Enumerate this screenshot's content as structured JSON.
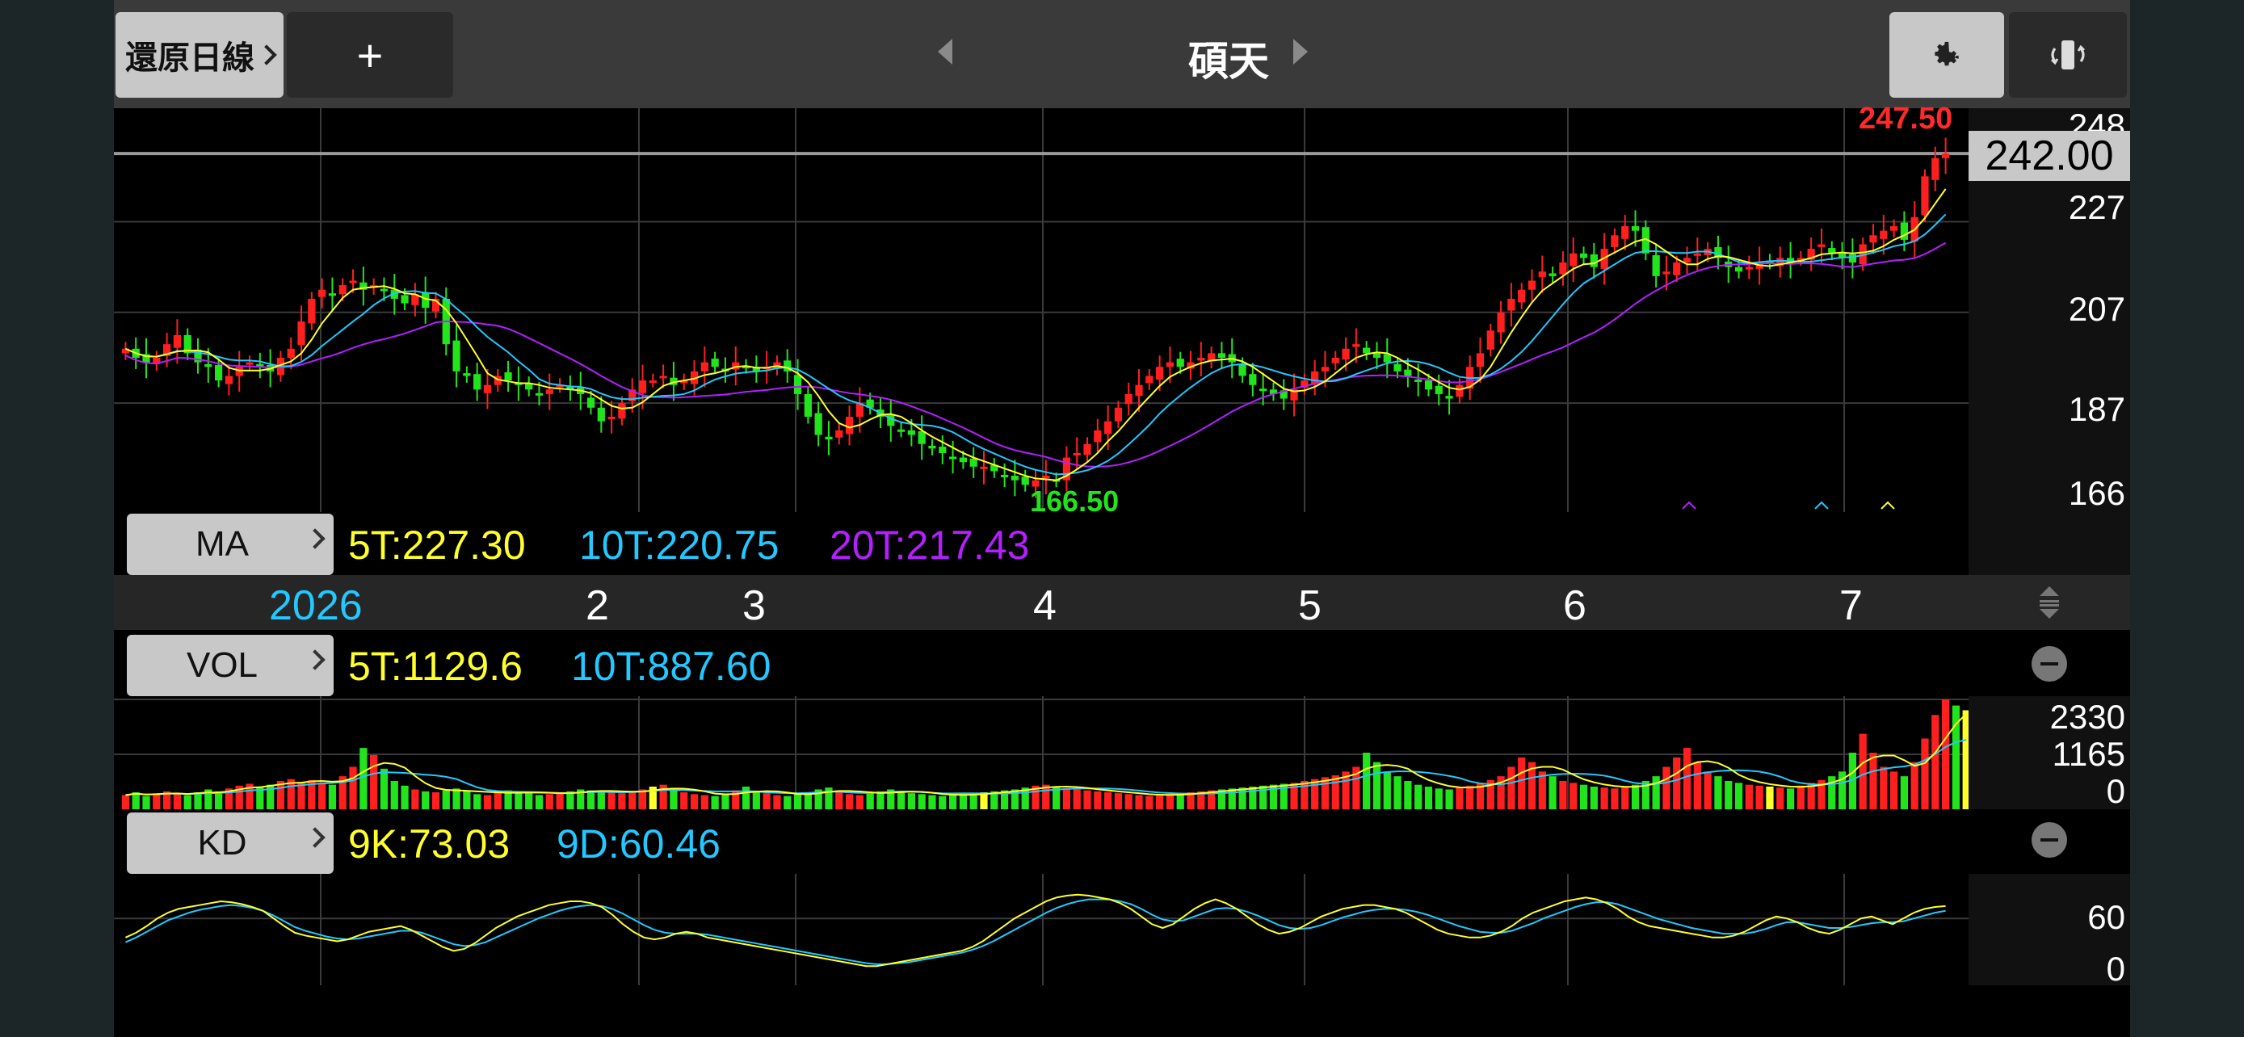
{
  "toolbar": {
    "restore_label": "還原日線",
    "add_label": "+",
    "stock_name": "碩天",
    "gear_icon": "gear-icon",
    "rotate_icon": "rotate-screen-icon"
  },
  "colors": {
    "up": "#ff1f1f",
    "down": "#22e41c",
    "ma5": "#ffff2a",
    "ma10": "#22c8ff",
    "ma20": "#b41fff",
    "grid": "#3a3a3a"
  },
  "ma_panel": {
    "button": "MA",
    "ma5": "5T:227.30",
    "ma10": "10T:220.75",
    "ma20": "20T:217.43"
  },
  "vol_panel": {
    "button": "VOL",
    "ma5": "5T:1129.6",
    "ma10": "10T:887.60"
  },
  "kd_panel": {
    "button": "KD",
    "k": "9K:73.03",
    "d": "9D:60.46"
  },
  "chart_data": {
    "type": "candlestick",
    "current_price": "242.00",
    "high_label": "247.50",
    "low_label": "166.50",
    "price_axis": [
      "248",
      "227",
      "207",
      "187",
      "166"
    ],
    "price_range": [
      163,
      252
    ],
    "months": [
      "2026",
      "2",
      "3",
      "4",
      "5",
      "6",
      "7"
    ],
    "closes": [
      199,
      197,
      196,
      197,
      200,
      202,
      198,
      196,
      195,
      192,
      193,
      195,
      196,
      195,
      194,
      197,
      199,
      205,
      210,
      212,
      211,
      213,
      214,
      212,
      213,
      212,
      210,
      209,
      211,
      208,
      210,
      200,
      194,
      193,
      190,
      191,
      193,
      192,
      191,
      190,
      189,
      190,
      191,
      190,
      189,
      186,
      183,
      184,
      187,
      190,
      192,
      192,
      193,
      191,
      192,
      194,
      196,
      195,
      194,
      196,
      195,
      194,
      195,
      196,
      194,
      189,
      184,
      180,
      179,
      181,
      184,
      187,
      186,
      184,
      182,
      181,
      180,
      178,
      177,
      176,
      175,
      174,
      173,
      173,
      172,
      171,
      170,
      169,
      170,
      171,
      170,
      175,
      176,
      178,
      181,
      183,
      186,
      189,
      191,
      193,
      195,
      196,
      195,
      196,
      197,
      198,
      197,
      196,
      193,
      191,
      190,
      189,
      188,
      190,
      192,
      194,
      195,
      197,
      199,
      200,
      198,
      197,
      196,
      194,
      193,
      192,
      190,
      189,
      188,
      191,
      195,
      198,
      203,
      207,
      210,
      212,
      214,
      216,
      215,
      218,
      220,
      219,
      217,
      221,
      224,
      226,
      225,
      220,
      215,
      216,
      218,
      219,
      220,
      221,
      219,
      217,
      216,
      217,
      218,
      218,
      219,
      218,
      219,
      221,
      222,
      220,
      219,
      218,
      222,
      224,
      225,
      226,
      223,
      228,
      237,
      241,
      242
    ],
    "volume_axis": [
      "2330",
      "1165",
      "0"
    ],
    "volume_max": 2330,
    "volume": [
      300,
      360,
      280,
      340,
      380,
      320,
      300,
      360,
      420,
      380,
      440,
      500,
      540,
      480,
      520,
      600,
      640,
      580,
      620,
      560,
      520,
      700,
      900,
      1300,
      1150,
      860,
      600,
      500,
      420,
      380,
      360,
      400,
      440,
      380,
      320,
      300,
      350,
      400,
      380,
      340,
      300,
      320,
      360,
      380,
      420,
      400,
      380,
      360,
      340,
      380,
      420,
      480,
      520,
      400,
      360,
      320,
      300,
      280,
      320,
      400,
      480,
      380,
      340,
      300,
      280,
      320,
      360,
      420,
      460,
      380,
      320,
      300,
      340,
      380,
      420,
      380,
      340,
      320,
      300,
      280,
      300,
      320,
      340,
      360,
      380,
      400,
      420,
      460,
      500,
      520,
      480,
      440,
      420,
      400,
      380,
      360,
      340,
      320,
      300,
      280,
      300,
      320,
      340,
      360,
      380,
      400,
      420,
      440,
      460,
      480,
      500,
      520,
      540,
      560,
      600,
      640,
      680,
      720,
      800,
      900,
      1200,
      1000,
      800,
      700,
      600,
      520,
      480,
      440,
      420,
      460,
      500,
      560,
      620,
      700,
      900,
      1100,
      1000,
      800,
      700,
      600,
      560,
      520,
      480,
      460,
      440,
      480,
      520,
      600,
      700,
      900,
      1100,
      1300,
      1000,
      800,
      700,
      600,
      560,
      520,
      500,
      480,
      460,
      440,
      500,
      560,
      620,
      700,
      800,
      1200,
      1600,
      1200,
      900,
      800,
      700,
      1000,
      1500,
      2000,
      2330,
      2200,
      2100
    ],
    "kd_axis": [
      "60",
      "0"
    ],
    "k": [
      40,
      45,
      52,
      60,
      66,
      70,
      72,
      74,
      76,
      78,
      77,
      75,
      72,
      68,
      60,
      52,
      45,
      42,
      40,
      38,
      36,
      38,
      42,
      46,
      48,
      50,
      52,
      48,
      42,
      36,
      30,
      26,
      28,
      34,
      42,
      50,
      56,
      62,
      66,
      70,
      74,
      76,
      78,
      78,
      76,
      72,
      64,
      54,
      46,
      40,
      38,
      40,
      44,
      46,
      44,
      40,
      38,
      36,
      34,
      32,
      30,
      28,
      26,
      24,
      22,
      20,
      18,
      16,
      14,
      12,
      10,
      10,
      12,
      14,
      16,
      18,
      20,
      22,
      24,
      26,
      30,
      36,
      44,
      52,
      60,
      66,
      72,
      78,
      82,
      84,
      85,
      84,
      82,
      80,
      76,
      70,
      62,
      54,
      50,
      54,
      62,
      70,
      76,
      80,
      76,
      70,
      62,
      54,
      48,
      44,
      46,
      50,
      56,
      62,
      66,
      70,
      72,
      74,
      74,
      72,
      70,
      66,
      60,
      54,
      48,
      44,
      42,
      40,
      40,
      42,
      46,
      52,
      60,
      66,
      70,
      74,
      78,
      80,
      82,
      80,
      76,
      70,
      62,
      56,
      52,
      50,
      48,
      46,
      44,
      42,
      40,
      40,
      42,
      46,
      52,
      58,
      62,
      60,
      56,
      50,
      46,
      44,
      48,
      54,
      60,
      62,
      58,
      54,
      60,
      66,
      70,
      72,
      73
    ],
    "d": [
      35,
      40,
      46,
      52,
      58,
      62,
      66,
      69,
      71,
      73,
      74,
      73,
      71,
      68,
      63,
      57,
      51,
      47,
      44,
      41,
      39,
      38,
      39,
      41,
      43,
      45,
      47,
      47,
      45,
      41,
      37,
      33,
      31,
      32,
      35,
      40,
      45,
      50,
      55,
      60,
      64,
      68,
      71,
      73,
      74,
      73,
      70,
      65,
      59,
      53,
      48,
      45,
      44,
      44,
      44,
      43,
      41,
      39,
      37,
      35,
      33,
      31,
      29,
      27,
      25,
      23,
      21,
      19,
      17,
      15,
      13,
      12,
      12,
      13,
      14,
      16,
      18,
      20,
      22,
      24,
      27,
      31,
      36,
      42,
      48,
      54,
      60,
      66,
      71,
      75,
      78,
      80,
      80,
      80,
      78,
      75,
      70,
      64,
      59,
      57,
      58,
      62,
      66,
      70,
      71,
      70,
      67,
      63,
      58,
      53,
      50,
      49,
      50,
      53,
      57,
      61,
      64,
      67,
      69,
      70,
      70,
      69,
      67,
      64,
      60,
      56,
      52,
      49,
      46,
      45,
      45,
      47,
      51,
      55,
      60,
      64,
      68,
      72,
      75,
      77,
      77,
      75,
      71,
      67,
      63,
      59,
      56,
      53,
      50,
      48,
      46,
      44,
      44,
      44,
      46,
      49,
      53,
      56,
      56,
      54,
      52,
      50,
      50,
      51,
      53,
      55,
      56,
      56,
      57,
      60,
      63,
      66,
      68
    ]
  }
}
